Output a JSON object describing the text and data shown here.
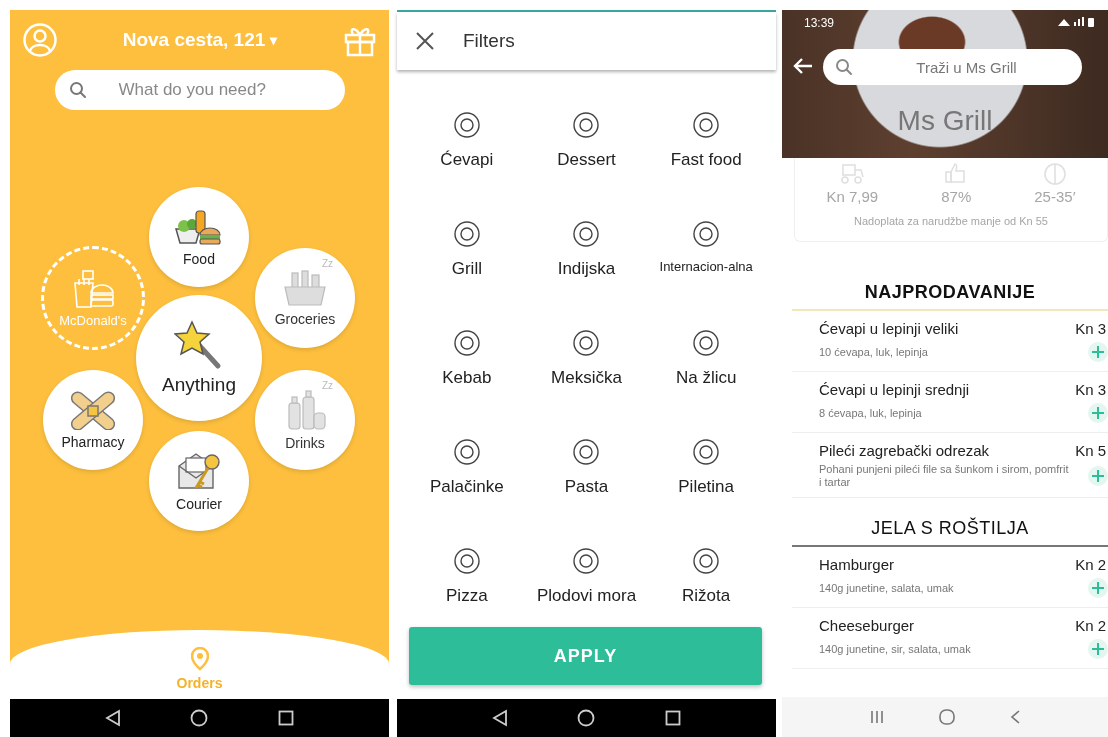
{
  "home": {
    "address": "Nova cesta, 121",
    "address_caret": "▾",
    "search": {
      "placeholder": "What do you need?"
    },
    "categories": [
      {
        "label": "Food",
        "kind": "open"
      },
      {
        "label": "McDonald's",
        "kind": "promo"
      },
      {
        "label": "Groceries",
        "kind": "closed",
        "sleep_mark": "Zz"
      },
      {
        "label": "Anything",
        "kind": "featured"
      },
      {
        "label": "Pharmacy",
        "kind": "open"
      },
      {
        "label": "Drinks",
        "kind": "closed",
        "sleep_mark": "Zz"
      },
      {
        "label": "Courier",
        "kind": "open"
      }
    ],
    "bottom_nav": {
      "label": "Orders",
      "selected": true
    }
  },
  "filters": {
    "title": "Filters",
    "items": [
      {
        "label": "Ćevapi"
      },
      {
        "label": "Dessert"
      },
      {
        "label": "Fast food"
      },
      {
        "label": "Grill"
      },
      {
        "label": "Indijska"
      },
      {
        "label": "Internacion-alna"
      },
      {
        "label": "Kebab"
      },
      {
        "label": "Meksička"
      },
      {
        "label": "Na žlicu"
      },
      {
        "label": "Palačinke"
      },
      {
        "label": "Pasta"
      },
      {
        "label": "Piletina"
      },
      {
        "label": "Pizza"
      },
      {
        "label": "Plodovi mora"
      },
      {
        "label": "Rižota"
      }
    ],
    "apply_button": "APPLY"
  },
  "restaurant": {
    "status_time": "13:39",
    "search": {
      "placeholder": "Traži u Ms Grill"
    },
    "name": "Ms Grill",
    "info": {
      "delivery_fee": "Kn 7,99",
      "rating": "87%",
      "time": "25-35′",
      "note": "Nadoplata za narudžbe manje od Kn 55"
    },
    "sections": [
      {
        "title": "NAJPRODAVANIJE",
        "selected": true,
        "items": [
          {
            "name": "Ćevapi u lepinji veliki",
            "description": "10 ćevapa, luk, lepinja",
            "price": "Kn 3"
          },
          {
            "name": "Ćevapi u lepinji srednji",
            "description": "8 ćevapa, luk, lepinja",
            "price": "Kn 3"
          },
          {
            "name": "Pileći zagrebački odrezak",
            "description": "Pohani punjeni pileći file sa šunkom i sirom, pomfrit i tartar",
            "price": "Kn 5"
          }
        ]
      },
      {
        "title": "JELA S ROŠTILJA",
        "selected": false,
        "items": [
          {
            "name": "Hamburger",
            "description": "140g junetine, salata, umak",
            "price": "Kn 2"
          },
          {
            "name": "Cheeseburger",
            "description": "140g junetine, sir, salata, umak",
            "price": "Kn 2"
          }
        ]
      }
    ]
  }
}
